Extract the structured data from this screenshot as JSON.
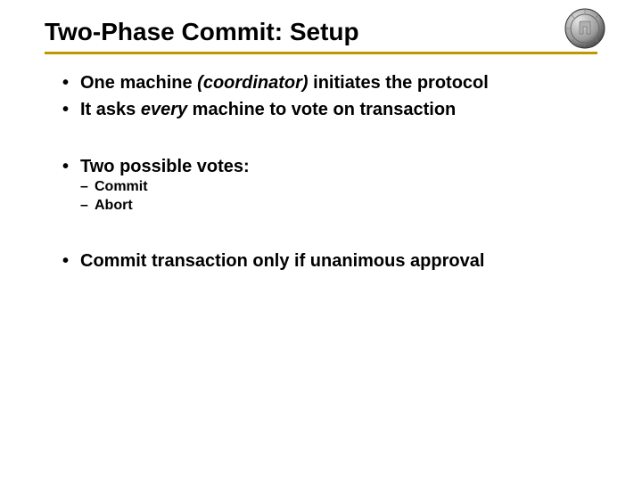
{
  "title": "Two-Phase Commit: Setup",
  "b1_a": "One machine ",
  "b1_b": "(coordinator)",
  "b1_c": " initiates the protocol",
  "b2_a": "It asks ",
  "b2_b": "every",
  "b2_c": " machine to vote on transaction",
  "b3": "Two possible votes:",
  "b3s1": "Commit",
  "b3s2": "Abort",
  "b4": "Commit transaction only if unanimous approval"
}
